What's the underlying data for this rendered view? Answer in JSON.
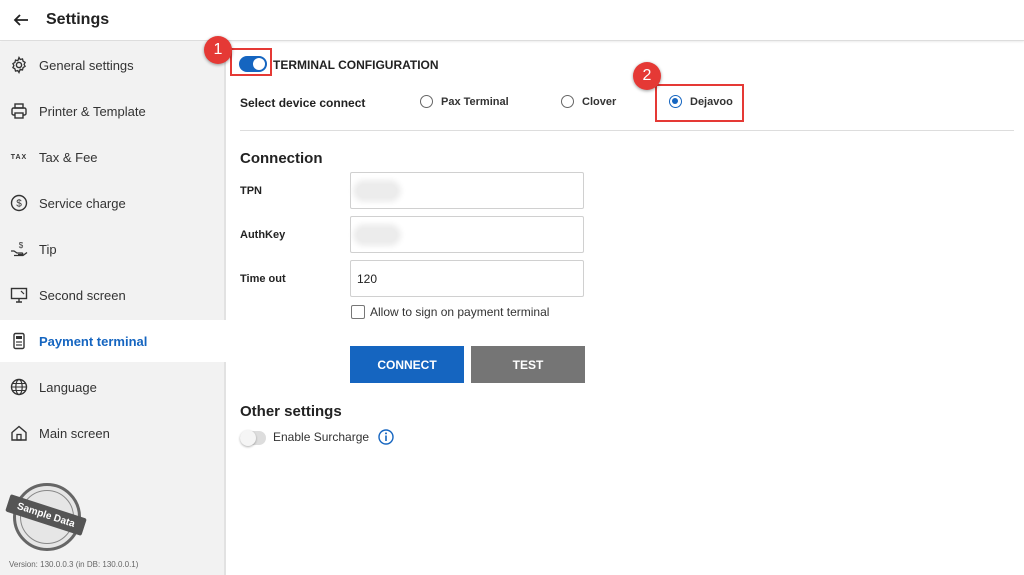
{
  "header": {
    "title": "Settings",
    "back_icon": "arrow-left-icon"
  },
  "sidebar": {
    "items": [
      {
        "label": "General settings",
        "icon": "gear-icon",
        "active": false
      },
      {
        "label": "Printer & Template",
        "icon": "printer-icon",
        "active": false
      },
      {
        "label": "Tax & Fee",
        "icon": "tax-icon",
        "icon_text": "TAX",
        "active": false
      },
      {
        "label": "Service charge",
        "icon": "dollar-circle-icon",
        "active": false
      },
      {
        "label": "Tip",
        "icon": "hand-coin-icon",
        "active": false
      },
      {
        "label": "Second screen",
        "icon": "monitor-icon",
        "active": false
      },
      {
        "label": "Payment terminal",
        "icon": "terminal-icon",
        "active": true
      },
      {
        "label": "Language",
        "icon": "globe-icon",
        "active": false
      },
      {
        "label": "Main screen",
        "icon": "home-icon",
        "active": false
      }
    ],
    "stamp_text": "Sample Data",
    "version": "Version:  130.0.0.3 (in DB: 130.0.0.1)"
  },
  "terminal": {
    "toggle_on": true,
    "title": "TERMINAL CONFIGURATION",
    "device_label": "Select device connect",
    "devices": [
      {
        "label": "Pax Terminal",
        "selected": false
      },
      {
        "label": "Clover",
        "selected": false
      },
      {
        "label": "Dejavoo",
        "selected": true
      }
    ]
  },
  "annotations": {
    "marker1": "1",
    "marker2": "2",
    "color": "#e53935"
  },
  "connection": {
    "heading": "Connection",
    "tpn_label": "TPN",
    "authkey_label": "AuthKey",
    "timeout_label": "Time out",
    "timeout_value": "120",
    "allow_sign_label": "Allow to sign on payment terminal",
    "allow_sign_checked": false,
    "connect_label": "CONNECT",
    "test_label": "TEST"
  },
  "other": {
    "heading": "Other settings",
    "surcharge_label": "Enable Surcharge",
    "surcharge_on": false
  },
  "colors": {
    "accent": "#1565c0",
    "test_button": "#757575",
    "sidebar_bg": "#f2f2f2"
  }
}
